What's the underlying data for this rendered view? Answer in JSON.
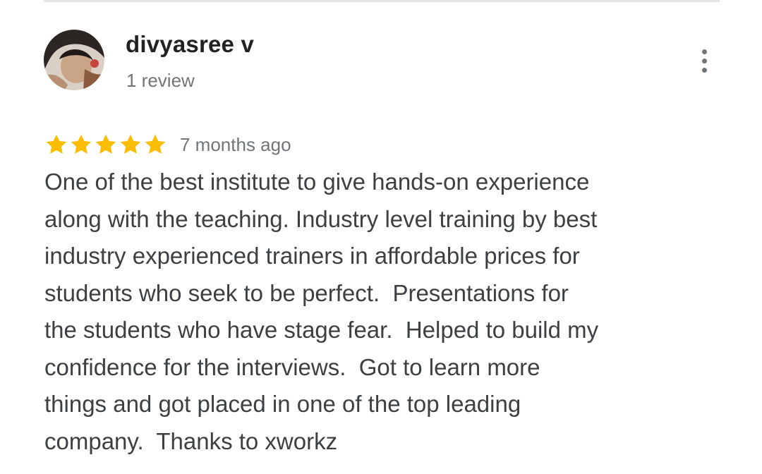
{
  "review": {
    "reviewer_name": "divyasree v",
    "reviewer_meta": "1 review",
    "rating": 5,
    "rating_max": 5,
    "timestamp": "7 months ago",
    "text_lines": [
      "One of the best institute to give hands-on experience",
      "along with the teaching. Industry level training by best",
      "industry experienced trainers in affordable prices for",
      "students who seek to be perfect.  Presentations for",
      "the students who have stage fear.  Helped to build my",
      "confidence for the interviews.  Got to learn more",
      "things and got placed in one of the top leading",
      "company.  Thanks to xworkz"
    ]
  },
  "icons": {
    "more": "more-vert-icon",
    "star": "star-icon"
  },
  "colors": {
    "star": "#fbbc04",
    "name": "#222222",
    "meta": "#70757a",
    "body_text": "#3c4043"
  }
}
